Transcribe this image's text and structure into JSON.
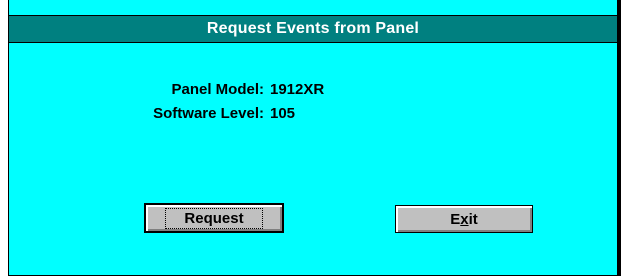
{
  "window": {
    "title": "Request Events from Panel"
  },
  "info": {
    "panel_model_label": "Panel Model:",
    "panel_model_value": "1912XR",
    "software_level_label": "Software Level:",
    "software_level_value": "105"
  },
  "buttons": {
    "request_label": "Request",
    "exit_prefix": "E",
    "exit_mnemonic": "x",
    "exit_suffix": "it"
  },
  "colors": {
    "client_background": "#00ffff",
    "titlebar": "#008080",
    "button_face": "#c0c0c0"
  }
}
